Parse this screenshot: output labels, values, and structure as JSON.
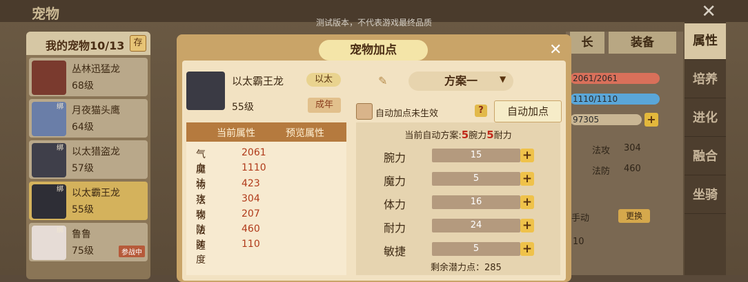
{
  "screen": {
    "title": "宠物",
    "notice": "测试版本，不代表游戏最终品质",
    "close": "✕"
  },
  "pet_list": {
    "header": "我的宠物10/13",
    "store_label": "存",
    "items": [
      {
        "name": "丛林迅猛龙",
        "level": "68级",
        "bind": "",
        "tag": ""
      },
      {
        "name": "月夜猫头鹰",
        "level": "64级",
        "bind": "绑",
        "tag": ""
      },
      {
        "name": "以太猎盗龙",
        "level": "57级",
        "bind": "绑",
        "tag": ""
      },
      {
        "name": "以太霸王龙",
        "level": "55级",
        "bind": "绑",
        "tag": ""
      },
      {
        "name": "鲁鲁",
        "level": "75级",
        "bind": "绑",
        "tag": "参战中"
      }
    ]
  },
  "right_tabs": [
    "属性",
    "培养",
    "进化",
    "融合",
    "坐骑"
  ],
  "background": {
    "tab_long": "长",
    "tab_equip": "装备",
    "hp": "2061/2061",
    "mp": "1110/1110",
    "exp": "97305",
    "magic_atk_label": "法攻",
    "magic_atk": "304",
    "magic_def_label": "法防",
    "magic_def": "460",
    "manual": "手动",
    "swap": "更换",
    "ten": "10"
  },
  "dialog": {
    "title": "宠物加点",
    "close": "✕",
    "pet_name": "以太霸王龙",
    "team_tag": "以太",
    "level": "55级",
    "adult": "成年",
    "plan": "方案一",
    "auto_checkbox_label": "自动加点未生效",
    "help": "?",
    "auto_button": "自动加点",
    "table_headers": [
      "当前属性",
      "预览属性"
    ],
    "stats": [
      {
        "k": "气血",
        "v": "2061"
      },
      {
        "k": "魔法",
        "v": "1110"
      },
      {
        "k": "物攻",
        "v": "423"
      },
      {
        "k": "法攻",
        "v": "304"
      },
      {
        "k": "物防",
        "v": "207"
      },
      {
        "k": "法防",
        "v": "460"
      },
      {
        "k": "速度",
        "v": "110"
      }
    ],
    "auto_plan_prefix": "当前自动方案:",
    "auto_plan_n1": "5",
    "auto_plan_a1": "腕力",
    "auto_plan_n2": "5",
    "auto_plan_a2": "耐力",
    "attributes": [
      {
        "k": "腕力",
        "v": "15"
      },
      {
        "k": "魔力",
        "v": "5"
      },
      {
        "k": "体力",
        "v": "16"
      },
      {
        "k": "耐力",
        "v": "24"
      },
      {
        "k": "敏捷",
        "v": "5"
      }
    ],
    "plus": "+",
    "remaining": "剩余潜力点：285"
  }
}
